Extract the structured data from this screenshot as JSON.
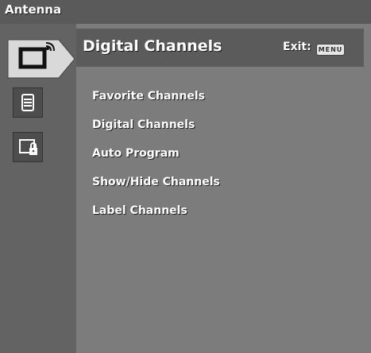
{
  "topbar": {
    "title": "Antenna"
  },
  "header": {
    "title": "Digital Channels",
    "exit_label": "Exit:",
    "exit_key": "MENU"
  },
  "sidebar": {
    "icons": [
      {
        "name": "tv-antenna-icon",
        "active": true
      },
      {
        "name": "channel-list-icon",
        "active": false
      },
      {
        "name": "parental-lock-icon",
        "active": false
      }
    ]
  },
  "menu": {
    "items": [
      {
        "label": "Favorite Channels"
      },
      {
        "label": "Digital Channels"
      },
      {
        "label": "Auto Program"
      },
      {
        "label": "Show/Hide Channels"
      },
      {
        "label": "Label Channels"
      }
    ]
  },
  "colors": {
    "panel": "#7c7c7c",
    "header": "#5b5b5b",
    "text": "#ffffff"
  }
}
